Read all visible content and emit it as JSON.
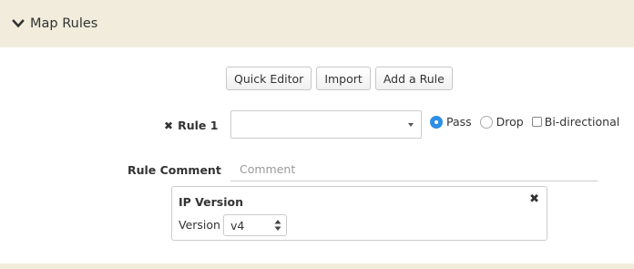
{
  "panel": {
    "title": "Map Rules",
    "toggle_icon": "chevron-down-icon"
  },
  "toolbar": {
    "quick_editor_label": "Quick Editor",
    "import_label": "Import",
    "add_rule_label": "Add a Rule"
  },
  "rule": {
    "label": "Rule 1",
    "remove_icon": "close-icon",
    "select_value": "",
    "action_options": [
      {
        "label": "Pass",
        "selected": true
      },
      {
        "label": "Drop",
        "selected": false
      }
    ],
    "bidirectional_label": "Bi-directional",
    "bidirectional_checked": false
  },
  "comment": {
    "label": "Rule Comment",
    "placeholder": "Comment",
    "value": ""
  },
  "ip_version": {
    "title": "IP Version",
    "version_label": "Version",
    "version_value": "v4",
    "close_icon": "close-icon"
  },
  "colors": {
    "header_bg": "#f1ecdc",
    "radio_selected": "#2f8fe5",
    "border": "#cccccc"
  }
}
